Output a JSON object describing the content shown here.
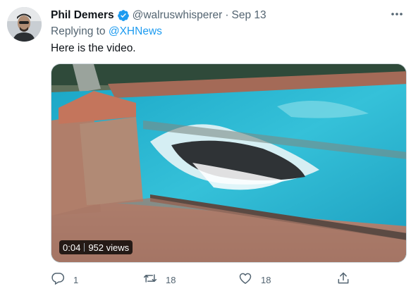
{
  "tweet": {
    "display_name": "Phil Demers",
    "verified": true,
    "handle": "@walruswhisperer",
    "separator": "·",
    "date": "Sep 13",
    "reply_prefix": "Replying to",
    "reply_mention": "@XHNews",
    "text": "Here is the video."
  },
  "media": {
    "type": "video",
    "duration": "0:04",
    "views": "952 views"
  },
  "actions": {
    "reply_count": "1",
    "retweet_count": "18",
    "like_count": "18"
  },
  "icons": {
    "verified": "verified-badge-icon",
    "more": "more-icon",
    "reply": "reply-icon",
    "retweet": "retweet-icon",
    "like": "heart-icon",
    "share": "share-icon"
  },
  "colors": {
    "accent": "#1d9bf0",
    "secondary_text": "#536471",
    "primary_text": "#0f1419"
  }
}
